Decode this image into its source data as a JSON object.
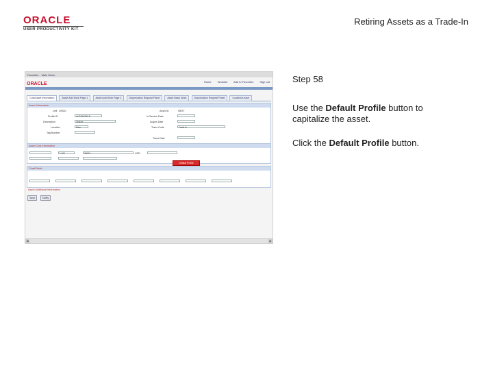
{
  "header": {
    "logo_text": "ORACLE",
    "logo_sub": "USER PRODUCTIVITY KIT",
    "title": "Retiring Assets as a Trade-In"
  },
  "instructions": {
    "step": "Step 58",
    "line1_pre": "Use the ",
    "line1_bold": "Default Profile",
    "line1_post": " button to capitalize the asset.",
    "line2_pre": "Click the ",
    "line2_bold": "Default Profile",
    "line2_post": " button."
  },
  "screenshot": {
    "brand": "ORACLE",
    "nav": [
      "Favorites",
      "Main Menu"
    ],
    "top_links": [
      "Home",
      "Worklist",
      "Add to Favorites",
      "Sign out"
    ],
    "tabs": [
      "Cost/Asset Information",
      "Asset Add Work Page 1",
      "Asset Add Work Page 2",
      "Depreciation Request Panel",
      "Asset Basic Work",
      "Depreciation Request Panel",
      "Location/Lease"
    ],
    "sections": {
      "acquisition": "Asset Information",
      "cost": "Asset Cost Information",
      "chartfields": "ChartFields",
      "additional": "Asset Additional Information"
    },
    "labels": {
      "unit": "Unit",
      "profile": "Profile ID",
      "description": "Description",
      "location": "Location",
      "tag": "Tag Number",
      "asset_id": "Asset ID",
      "in_service": "In Service Date",
      "acquis_date": "Acquis Date",
      "trans_code": "Trans Code",
      "trans_date": "Trans Date"
    },
    "values": {
      "unit": "US001",
      "asset_id": "NEXT",
      "profile": "AUTOMOBILE",
      "description": "Vehicle",
      "location": "Main",
      "quantity": "1.000",
      "cost": "30000",
      "currency": "USD",
      "trans_code": "Trade-In"
    },
    "highlight_button": "Default Profile",
    "buttons": [
      "Save",
      "Notify"
    ]
  }
}
